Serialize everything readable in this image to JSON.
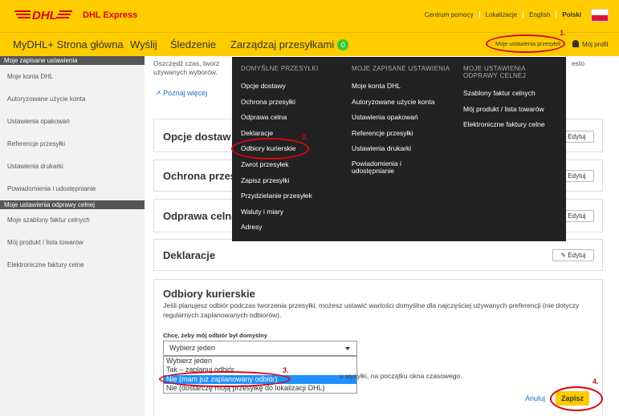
{
  "header": {
    "brand": "DHL Express",
    "links": [
      "Centrum pomocy",
      "Lokalizacje",
      "English",
      "Polski"
    ]
  },
  "nav": {
    "home": "MyDHL+ Strona główna",
    "send": "Wyślij",
    "track": "Śledzenie",
    "manage": "Zarządzaj przesyłkami",
    "manage_badge": "0",
    "settings": "Moje ustawienia przesyłek",
    "profile": "Mój profil"
  },
  "sidebar": {
    "section1": "Moje zapisane ustawienia",
    "items1": [
      "Moje konta DHL",
      "Autoryzowane użycie konta",
      "Ustawienia opakowań",
      "Referencje przesyłki",
      "Ustawienia drukarki",
      "Powiadomienia i udostępnianie"
    ],
    "section2": "Moje ustawienia odprawy celnej",
    "items2": [
      "Moje szablony faktur celnych",
      "Mój produkt / lista towarów",
      "Elektroniczne faktury celne"
    ]
  },
  "main": {
    "intro_start": "Oszczędź czas, tworz",
    "intro_end": "używanych wyborów.",
    "intro_tail": "esto",
    "learn_more": "Poznaj więcej",
    "cards": [
      "Opcje dostaw",
      "Ochrona przes",
      "Odprawa celna",
      "Deklaracje"
    ],
    "edit_label": "Edytuj"
  },
  "dropdown": {
    "col1_head": "DOMYŚLNE PRZESYŁKI",
    "col1": [
      "Opcje dostawy",
      "Ochrona przesyłki",
      "Odprawa celna",
      "Deklaracje",
      "Odbiory kurierskie",
      "Zwrot przesyłek",
      "Zapisz przesyłki",
      "Przydzielanie przesyłek",
      "Waluty i miary",
      "Adresy"
    ],
    "col2_head": "MOJE ZAPISANE USTAWIENIA",
    "col2": [
      "Moje konta DHL",
      "Autoryzowane użycie konta",
      "Ustawienia opakowań",
      "Referencje przesyłki",
      "Ustawienia drukarki",
      "Powiadomienia i udostępnianie"
    ],
    "col3_head": "MOJE USTAWIENIA ODPRAWY CELNEJ",
    "col3": [
      "Szablony faktur celnych",
      "Mój produkt / lista towarów",
      "Elektroniczne faktury celne"
    ]
  },
  "pickup": {
    "title": "Odbiory kurierskie",
    "desc": "Jeśli planujesz odbiór podczas tworzenia przesyłki, możesz ustawić wartości domyślne dla najczęściej używanych preferencji (nie dotyczy regularnych zaplanowanych odbiorów).",
    "field_label": "Chcę, żeby mój odbiór był domyślny",
    "selected": "Wybierz jeden",
    "options": [
      "Wybierz jeden",
      "Tak – zaplanuj odbiór",
      "Nie (mam już zaplanowany odbiór)",
      "Nie (dostarczę moją przesyłkę do lokalizacji DHL)"
    ],
    "hint": "u wysyłki, na początku okna czasowego.",
    "cancel": "Anuluj",
    "save": "Zapisz"
  },
  "annotations": [
    "1.",
    "2.",
    "3.",
    "4."
  ],
  "colors": {
    "dhl_yellow": "#ffcc00",
    "dhl_red": "#d40511",
    "menu_bg": "#222222",
    "selected_option": "#1e90ff"
  }
}
